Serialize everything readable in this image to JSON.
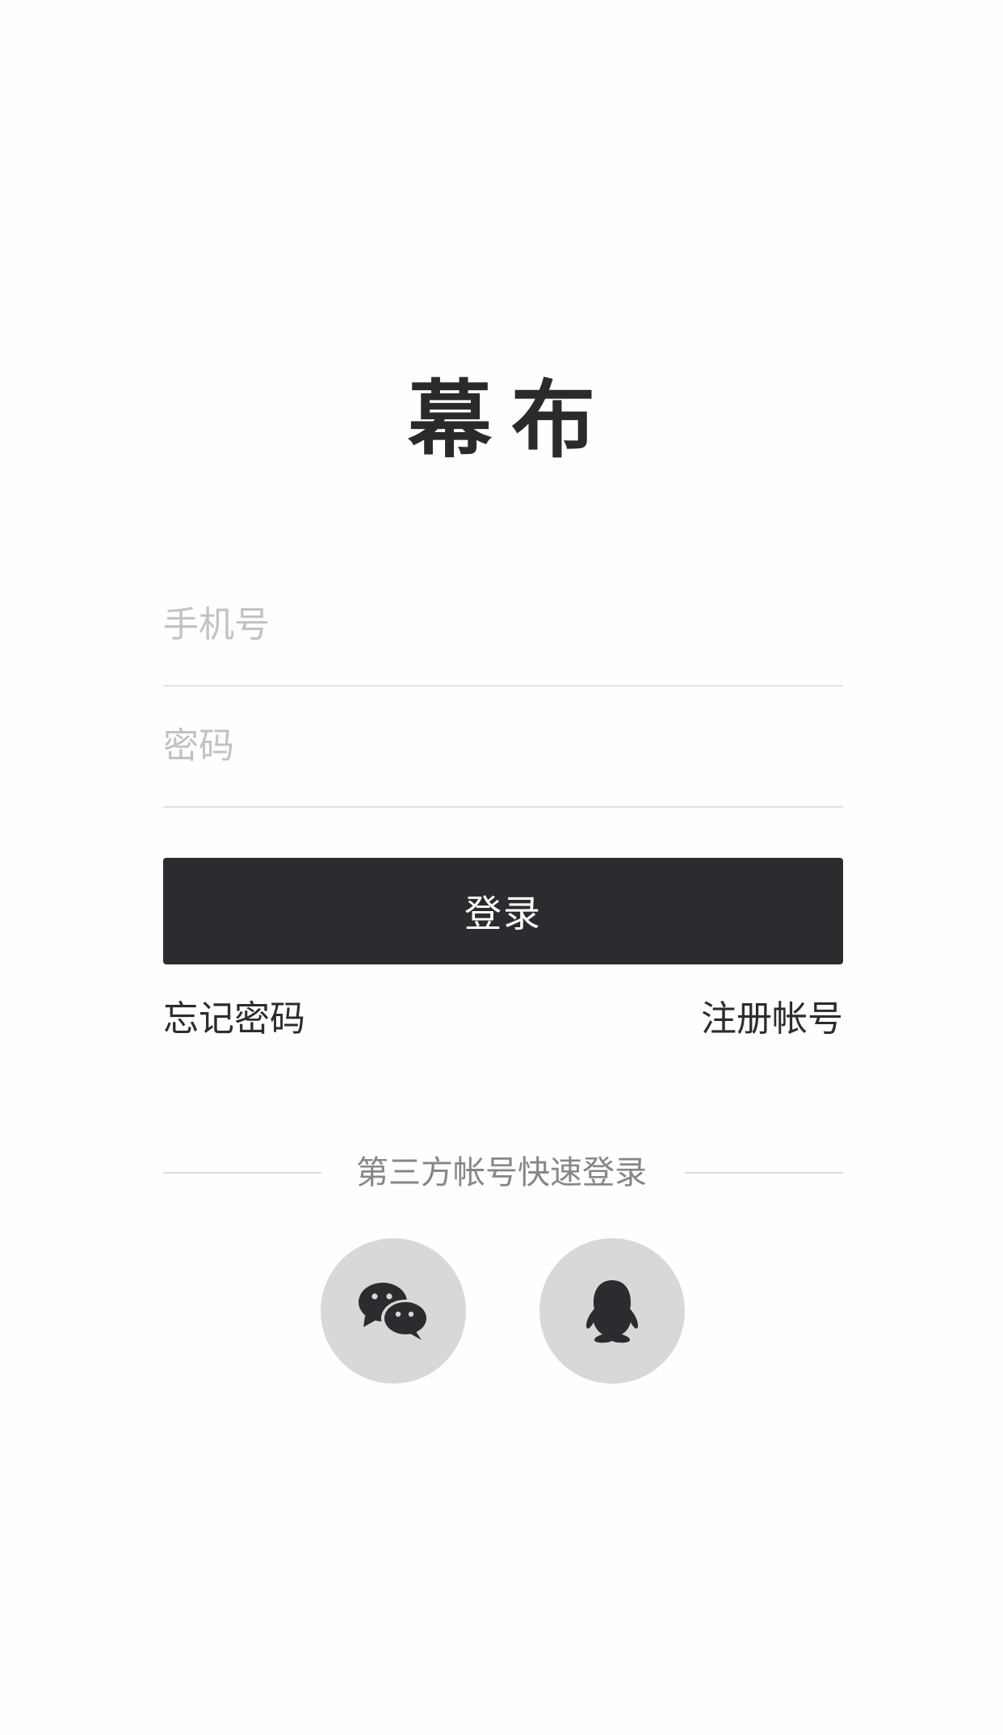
{
  "app": {
    "logo_text": "幕布"
  },
  "login_form": {
    "phone_placeholder": "手机号",
    "password_placeholder": "密码",
    "submit_label": "登录",
    "forgot_password_label": "忘记密码",
    "register_label": "注册帐号"
  },
  "third_party": {
    "divider_label": "第三方帐号快速登录",
    "providers": [
      {
        "name": "wechat",
        "icon": "wechat-icon"
      },
      {
        "name": "qq",
        "icon": "qq-icon"
      }
    ]
  },
  "colors": {
    "primary_dark": "#2b2c30",
    "placeholder": "#c2c2c6",
    "divider": "#e3e3e5",
    "social_bg": "#d8d8d8",
    "muted_text": "#86868a"
  }
}
